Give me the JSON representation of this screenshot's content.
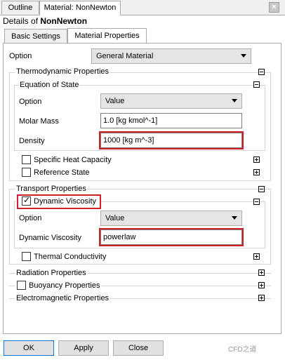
{
  "tabs": [
    "Outline",
    "Material: NonNewton"
  ],
  "details": {
    "prefix": "Details of",
    "name": "NonNewton"
  },
  "subtabs": [
    "Basic Settings",
    "Material Properties"
  ],
  "option": {
    "label": "Option",
    "value": "General Material"
  },
  "thermo": {
    "title": "Thermodynamic Properties",
    "eos": {
      "title": "Equation of State",
      "option_label": "Option",
      "option_value": "Value",
      "molar_label": "Molar Mass",
      "molar_value": "1.0 [kg kmol^-1]",
      "density_label": "Density",
      "density_value": "1000 [kg m^-3]"
    },
    "specific_heat": "Specific Heat Capacity",
    "reference_state": "Reference State"
  },
  "transport": {
    "title": "Transport Properties",
    "dv": {
      "title": "Dynamic Viscosity",
      "checked": true,
      "option_label": "Option",
      "option_value": "Value",
      "value_label": "Dynamic Viscosity",
      "value": "powerlaw"
    },
    "thermal": "Thermal Conductivity"
  },
  "radiation": "Radiation Properties",
  "buoyancy": "Buoyancy Properties",
  "electromagnetic": "Electromagnetic Properties",
  "buttons": {
    "ok": "OK",
    "apply": "Apply",
    "close": "Close"
  },
  "close_glyph": "×",
  "check_glyph": "✓",
  "watermark": "CFD之道",
  "colors": {
    "highlight": "#d0202a",
    "focus": "#0078d7"
  }
}
